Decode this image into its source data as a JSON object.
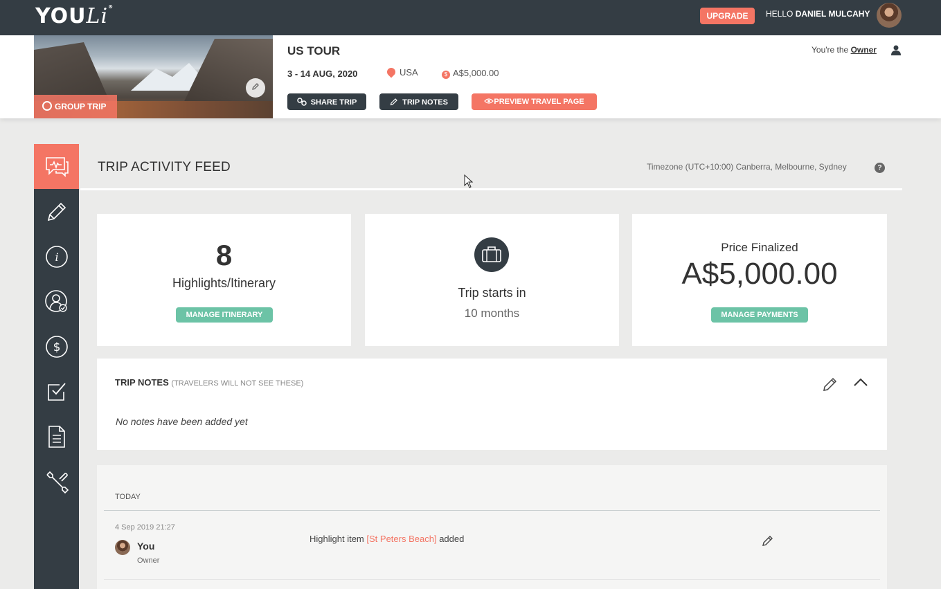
{
  "topbar": {
    "logo_text": "YOU",
    "logo_text_2": "Li",
    "logo_mark": "®",
    "upgrade_label": "UPGRADE",
    "greeting": "HELLO",
    "user_name": "DANIEL MULCAHY"
  },
  "trip": {
    "group_badge": "GROUP TRIP",
    "title": "US TOUR",
    "dates": "3 - 14 AUG, 2020",
    "location": "USA",
    "price": "A$5,000.00",
    "buttons": {
      "share": "SHARE TRIP",
      "notes": "TRIP NOTES",
      "preview": "PREVIEW TRAVEL PAGE"
    },
    "owner_prefix": "You're the",
    "owner_role": "Owner"
  },
  "sidebar": {
    "items": [
      {
        "icon": "activity-feed-icon",
        "active": true
      },
      {
        "icon": "pencil-icon"
      },
      {
        "icon": "info-icon"
      },
      {
        "icon": "travelers-icon"
      },
      {
        "icon": "dollar-icon"
      },
      {
        "icon": "checklist-icon"
      },
      {
        "icon": "document-icon"
      },
      {
        "icon": "wrench-icon"
      }
    ]
  },
  "feed": {
    "title": "TRIP ACTIVITY FEED",
    "timezone": "Timezone (UTC+10:00) Canberra, Melbourne, Sydney",
    "help": "?"
  },
  "stats": {
    "highlights_count": "8",
    "highlights_label": "Highlights/Itinerary",
    "manage_itinerary": "MANAGE ITINERARY",
    "starts_label": "Trip starts in",
    "starts_value": "10 months",
    "price_label": "Price Finalized",
    "price_value": "A$5,000.00",
    "manage_payments": "MANAGE PAYMENTS"
  },
  "notes": {
    "title": "TRIP NOTES",
    "subtitle": "(TRAVELERS WILL NOT SEE THESE)",
    "empty": "No notes have been added yet"
  },
  "activity": {
    "section": "TODAY",
    "items": [
      {
        "time": "4 Sep 2019 21:27",
        "user": "You",
        "role": "Owner",
        "prefix": "Highlight item",
        "highlight": "[St Peters Beach]",
        "suffix": "added"
      }
    ]
  },
  "colors": {
    "dark": "#343d44",
    "coral": "#f47564",
    "green": "#6cc3a6"
  }
}
